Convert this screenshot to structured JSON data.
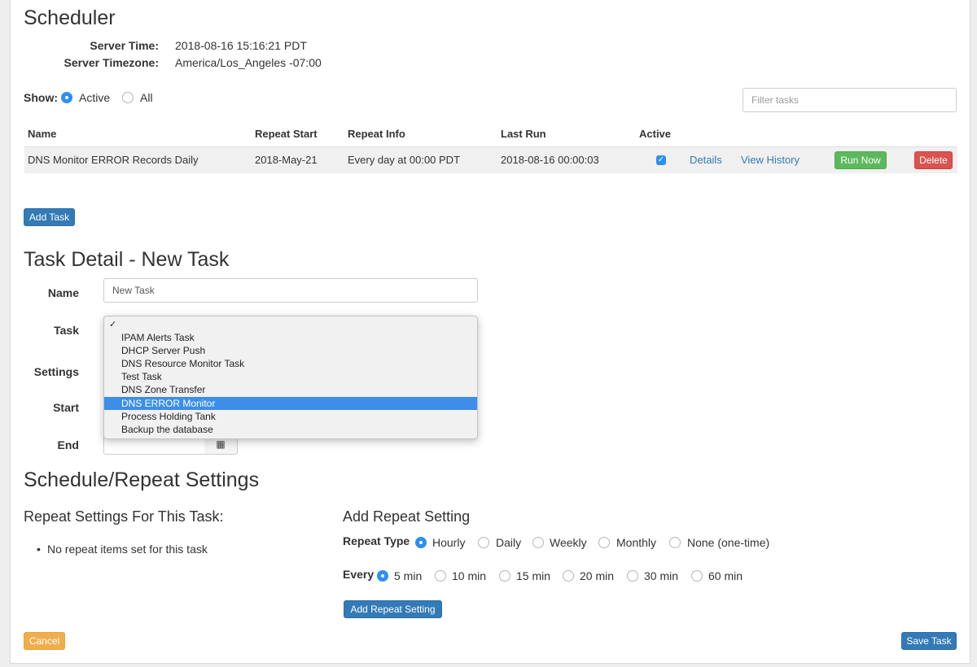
{
  "scheduler": {
    "title": "Scheduler",
    "server_time_label": "Server Time:",
    "server_time_value": "2018-08-16 15:16:21 PDT",
    "server_tz_label": "Server Timezone:",
    "server_tz_value": "America/Los_Angeles -07:00",
    "show_label": "Show:",
    "show_options": [
      "Active",
      "All"
    ],
    "show_selected": "Active",
    "filter_placeholder": "Filter tasks"
  },
  "tasks_table": {
    "headers": [
      "Name",
      "Repeat Start",
      "Repeat Info",
      "Last Run",
      "Active"
    ],
    "rows": [
      {
        "name": "DNS Monitor ERROR Records Daily",
        "repeat_start": "2018-May-21",
        "repeat_info": "Every day at 00:00 PDT",
        "last_run": "2018-08-16 00:00:03",
        "active": true,
        "details_link": "Details",
        "history_link": "View History",
        "run_now_label": "Run Now",
        "delete_label": "Delete"
      }
    ]
  },
  "add_task_label": "Add Task",
  "task_detail": {
    "title": "Task Detail - New Task",
    "name_label": "Name",
    "name_value": "New Task",
    "task_label": "Task",
    "settings_label": "Settings",
    "start_label": "Start",
    "end_label": "End",
    "task_dropdown": {
      "check_mark": "✓",
      "options": [
        "IPAM Alerts Task",
        "DHCP Server Push",
        "DNS Resource Monitor Task",
        "Test Task",
        "DNS Zone Transfer",
        "DNS ERROR Monitor",
        "Process Holding Tank",
        "Backup the database"
      ],
      "highlighted": "DNS ERROR Monitor"
    },
    "calendar_icon_glyph": "▦"
  },
  "schedule": {
    "title": "Schedule/Repeat Settings",
    "repeat_settings_title": "Repeat Settings For This Task:",
    "bullet": "•",
    "no_repeat_text": "No repeat items set for this task",
    "add_repeat_title": "Add Repeat Setting",
    "repeat_type_label": "Repeat Type",
    "repeat_types": [
      "Hourly",
      "Daily",
      "Weekly",
      "Monthly",
      "None (one-time)"
    ],
    "repeat_type_selected": "Hourly",
    "every_label": "Every",
    "every_options": [
      "5 min",
      "10 min",
      "15 min",
      "20 min",
      "30 min",
      "60 min"
    ],
    "every_selected": "5 min",
    "add_repeat_button": "Add Repeat Setting"
  },
  "footer": {
    "cancel_label": "Cancel",
    "save_label": "Save Task"
  },
  "colors": {
    "primary": "#337ab7",
    "success": "#5cb85c",
    "danger": "#d9534f",
    "warning": "#f0ad4e",
    "radio_active": "#2d8ff0",
    "dropdown_highlight": "#3d8ee8"
  }
}
